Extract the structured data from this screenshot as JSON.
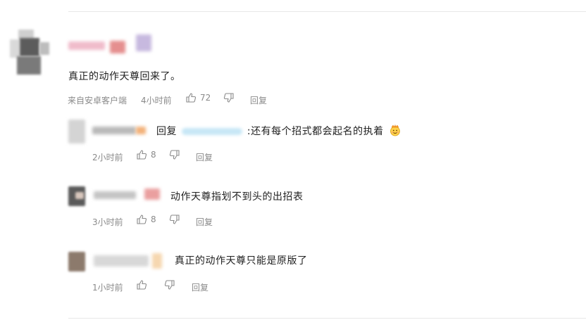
{
  "main_comment": {
    "text": "真正的动作天尊回来了。",
    "source": "来自安卓客户端",
    "time": "4小时前",
    "likes": "72",
    "reply_label": "回复"
  },
  "replies": [
    {
      "reply_prefix": "回复",
      "text": ":还有每个招式都会起名的执着",
      "emoji": "crowned-face-emoji",
      "time": "2小时前",
      "likes": "8",
      "reply_label": "回复"
    },
    {
      "text": "动作天尊指划不到头的出招表",
      "time": "3小时前",
      "likes": "8",
      "reply_label": "回复"
    },
    {
      "text": "真正的动作天尊只能是原版了",
      "time": "1小时前",
      "likes": "",
      "reply_label": "回复"
    }
  ],
  "icons": {
    "like": "thumbs-up-icon",
    "dislike": "thumbs-down-icon"
  },
  "colors": {
    "meta_text": "#8a8a8a",
    "divider": "#e8e8e8",
    "link_highlight": "#c7e7f6"
  }
}
